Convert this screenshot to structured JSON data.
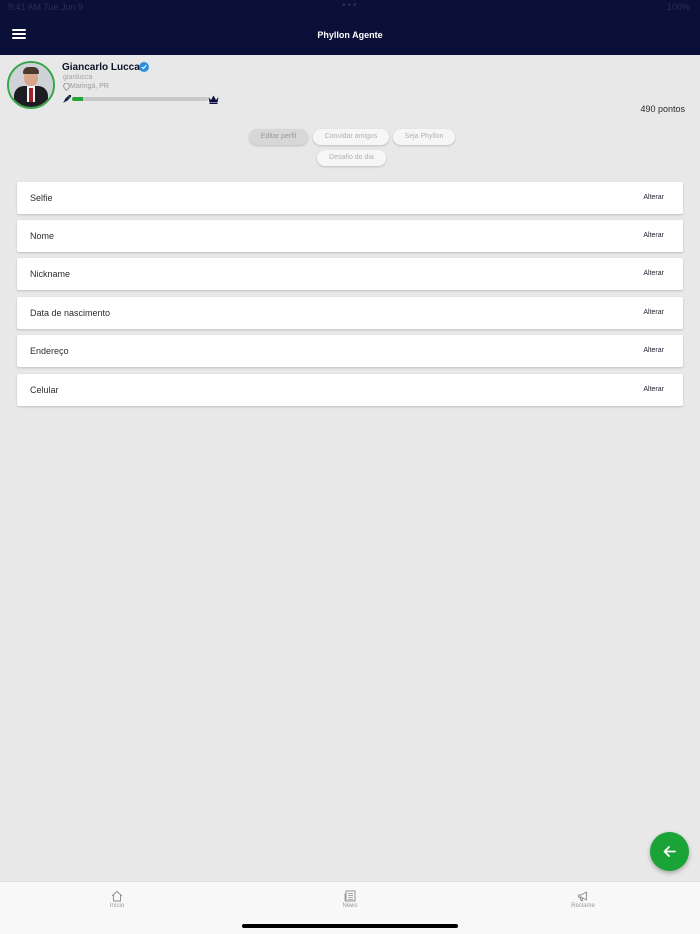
{
  "status_bar": {
    "left_text": "9:41 AM  Tue Jun 9",
    "right_text": "100%"
  },
  "header": {
    "title": "Phyllon Agente"
  },
  "profile": {
    "name": "Giancarlo Lucca",
    "username": "gianlucca",
    "location": "Maringá, PR",
    "points": "490 pontos",
    "level_progress": 0.08
  },
  "actions": [
    {
      "label": "Editar perfil"
    },
    {
      "label": "Convidar amigos"
    },
    {
      "label": "Seja Phyllon"
    },
    {
      "label": "Desafio do dia"
    }
  ],
  "fields": [
    {
      "label": "Selfie",
      "action": "Alterar"
    },
    {
      "label": "Nome",
      "action": "Alterar"
    },
    {
      "label": "Nickname",
      "action": "Alterar"
    },
    {
      "label": "Data de nascimento",
      "action": "Alterar"
    },
    {
      "label": "Endereço",
      "action": "Alterar"
    },
    {
      "label": "Celular",
      "action": "Alterar"
    }
  ],
  "bottom_nav": [
    {
      "label": "Início",
      "icon": "home-icon"
    },
    {
      "label": "News",
      "icon": "newspaper-icon"
    },
    {
      "label": "Reclame",
      "icon": "megaphone-icon"
    }
  ],
  "colors": {
    "header_bg": "#0b1038",
    "accent_green": "#1aa336",
    "verified_blue": "#2a8fe0",
    "page_bg": "#e8e8e8"
  }
}
